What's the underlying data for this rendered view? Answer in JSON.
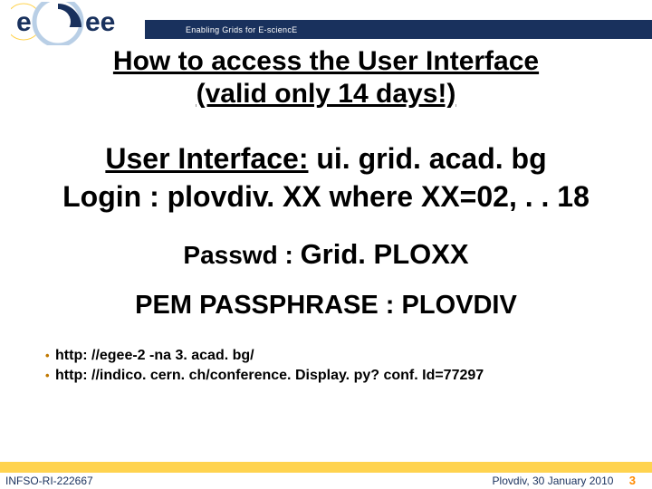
{
  "header": {
    "logo_text_1": "e",
    "logo_text_2": "ee",
    "tagline": "Enabling Grids for E-sciencE"
  },
  "title": {
    "line1": "How to access the User Interface",
    "line2": "(valid only 14 days!)"
  },
  "ui": {
    "label": "User Interface:",
    "value": " ui. grid. acad. bg"
  },
  "login": {
    "label": "Login",
    "value": " : plovdiv. XX  where XX=02, . . 18"
  },
  "passwd": {
    "label": "Passwd : ",
    "value": "Grid. PLOXX"
  },
  "pem": "PEM PASSPHRASE : PLOVDIV",
  "links": {
    "l1": "http: //egee-2 -na 3. acad. bg/",
    "l2": "http: //indico. cern. ch/conference. Display. py? conf. Id=77297"
  },
  "footer": {
    "project": "INFSO-RI-222667",
    "event": "Plovdiv, 30 January 2010",
    "page": "3"
  }
}
